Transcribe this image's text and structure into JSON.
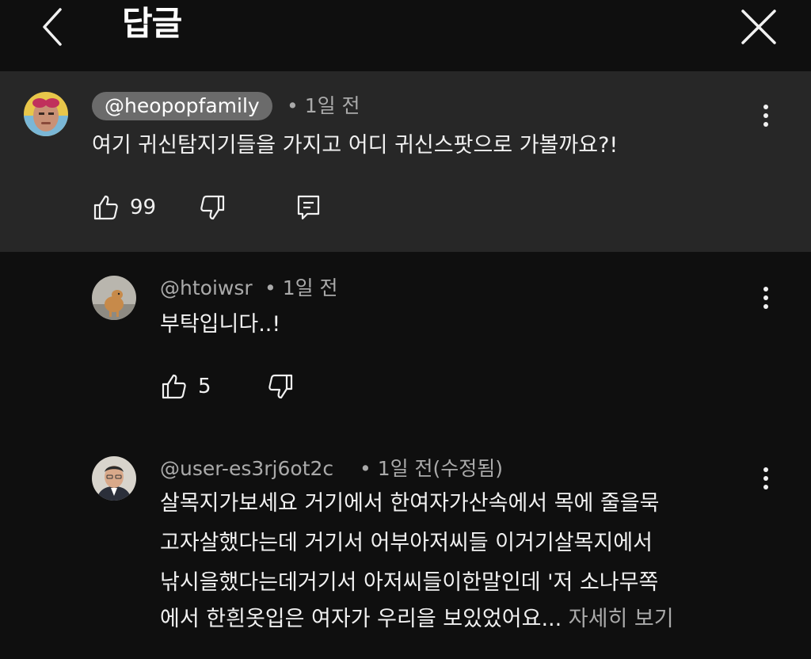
{
  "header": {
    "title": "답글"
  },
  "parent_comment": {
    "handle": "@heopopfamily",
    "time": "• 1일 전",
    "text": "여기 귀신탐지기들을 가지고 어디 귀신스팟으로 가볼까요?!",
    "likes": "99"
  },
  "replies": [
    {
      "handle": "@htoiwsr",
      "time": "• 1일 전",
      "lines": [
        "부탁입니다..!"
      ],
      "likes": "5"
    },
    {
      "handle": "@user-es3rj6ot2c",
      "time": "• 1일 전(수정됨)",
      "lines": [
        "살목지가보세요 거기에서 한여자가산속에서  목에 줄을묵",
        "고자살했다는데 거기서 어부아저씨들 이거기살목지에서",
        "낚시을했다는데거기서 아저씨들이한말인데 '저 소나무쪽",
        "에서 한흰옷입은 여자가 우리을 보있었어요..."
      ],
      "more": "자세히 보기"
    }
  ],
  "icons": {
    "back": "chevron-left-icon",
    "close": "close-icon",
    "like": "thumbs-up-icon",
    "dislike": "thumbs-down-icon",
    "reply": "comment-icon",
    "menu": "more-vertical-icon"
  },
  "colors": {
    "background": "#0f0f0f",
    "highlight": "#272727",
    "pill": "#6b6b6b",
    "text": "#f1f1f1",
    "secondary": "#aaaaaa"
  }
}
